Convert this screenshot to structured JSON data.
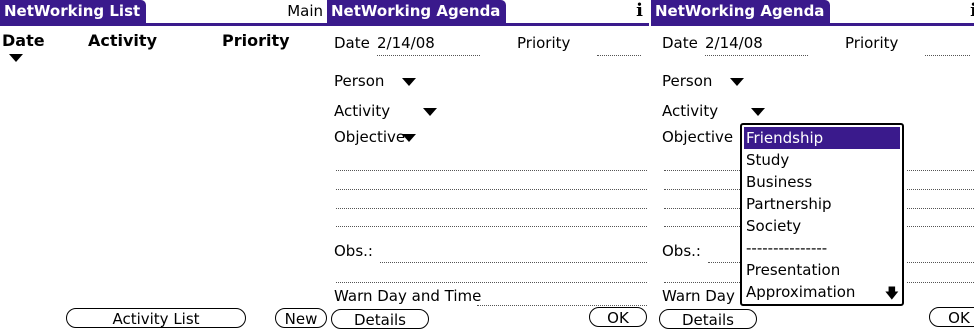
{
  "screen1": {
    "title": "NetWorking List",
    "menu_label": "Main",
    "columns": [
      "Date",
      "Activity",
      "Priority"
    ],
    "buttons": {
      "activity_list": "Activity List",
      "new": "New"
    }
  },
  "screen2": {
    "title": "NetWorking Agenda",
    "info": "i",
    "date_label": "Date",
    "date_value": "2/14/08",
    "priority_label": "Priority",
    "person_label": "Person",
    "activity_label": "Activity",
    "objective_label": "Objective",
    "obs_label": "Obs.:",
    "warn_label": "Warn Day and Time",
    "buttons": {
      "details": "Details",
      "ok": "OK"
    }
  },
  "screen3": {
    "title": "NetWorking Agenda",
    "info": "i",
    "date_label": "Date",
    "date_value": "2/14/08",
    "priority_label": "Priority",
    "person_label": "Person",
    "activity_label": "Activity",
    "objective_label": "Objective",
    "obs_label": "Obs.:",
    "warn_label": "Warn Day",
    "buttons": {
      "details": "Details",
      "ok": "OK"
    },
    "dropdown": {
      "options": [
        "Friendship",
        "Study",
        "Business",
        "Partnership",
        "Society",
        "---------------",
        "Presentation",
        "Approximation"
      ],
      "selected": "Friendship"
    }
  },
  "colors": {
    "title_bg": "#3a1a8c",
    "selection_bg": "#3a1a8c"
  }
}
